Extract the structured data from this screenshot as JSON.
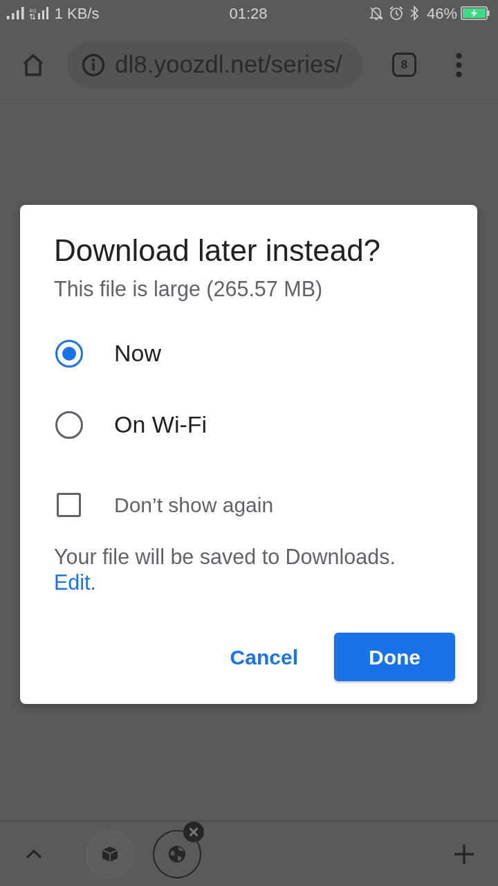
{
  "status_bar": {
    "network_type": "4G",
    "network_speed": "1 KB/s",
    "time": "01:28",
    "battery": "46%",
    "charging": true
  },
  "toolbar": {
    "url": "dl8.yoozdl.net/series/",
    "tab_count": "8"
  },
  "dialog": {
    "title": "Download later instead?",
    "subtitle": "This file is large (265.57 MB)",
    "options": [
      {
        "label": "Now",
        "selected": true
      },
      {
        "label": "On Wi-Fi",
        "selected": false
      }
    ],
    "dont_show_again": {
      "label": "Don’t show again",
      "checked": false
    },
    "location_note": {
      "text": "Your file will be saved to Downloads.",
      "link": "Edit",
      "after": "."
    },
    "buttons": [
      {
        "label": "Cancel",
        "kind": "text"
      },
      {
        "label": "Done",
        "kind": "filled"
      }
    ]
  },
  "bottom_bar": {
    "tabs": [
      {
        "selected": false
      },
      {
        "selected": true
      }
    ]
  }
}
